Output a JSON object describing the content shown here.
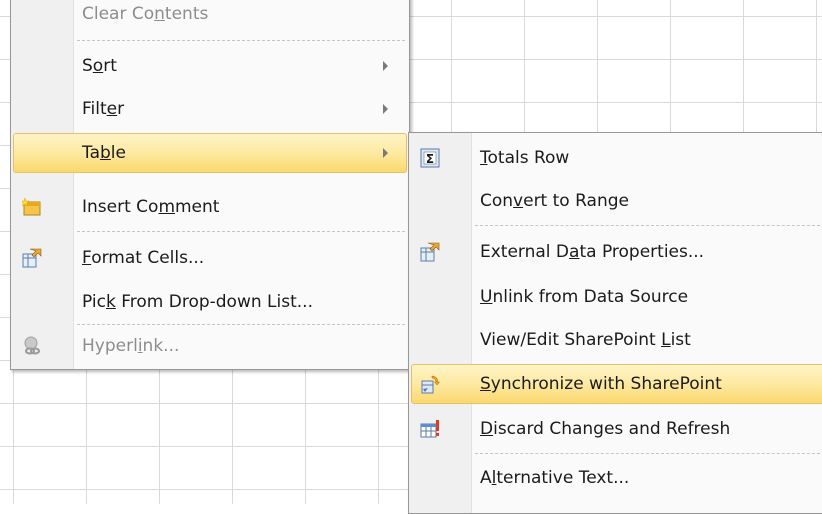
{
  "context_menu": {
    "items": [
      {
        "key": "clear_contents",
        "text": "Clear Contents",
        "pre": "Clear Co",
        "ul": "n",
        "post": "tents"
      },
      {
        "key": "sort",
        "text": "Sort",
        "pre": "S",
        "ul": "o",
        "post": "rt",
        "submenu": true
      },
      {
        "key": "filter",
        "text": "Filter",
        "pre": "Filt",
        "ul": "e",
        "post": "r",
        "submenu": true
      },
      {
        "key": "table",
        "text": "Table",
        "pre": "Ta",
        "ul": "b",
        "post": "le",
        "submenu": true,
        "highlighted": true
      },
      {
        "key": "insert_comment",
        "text": "Insert Comment",
        "pre": "Insert Co",
        "ul": "m",
        "post": "ment",
        "icon": "comment-icon"
      },
      {
        "key": "format_cells",
        "text": "Format Cells...",
        "pre": "",
        "ul": "F",
        "post": "ormat Cells...",
        "icon": "format-cells-icon"
      },
      {
        "key": "pick_list",
        "text": "Pick From Drop-down List...",
        "pre": "Pic",
        "ul": "k",
        "post": " From Drop-down List..."
      },
      {
        "key": "hyperlink",
        "text": "Hyperlink...",
        "pre": "Hyperl",
        "ul": "i",
        "post": "nk...",
        "icon": "hyperlink-icon",
        "disabled": true
      }
    ]
  },
  "table_submenu": {
    "items": [
      {
        "key": "totals_row",
        "text": "Totals Row",
        "pre": "",
        "ul": "T",
        "post": "otals Row",
        "icon": "sigma-icon"
      },
      {
        "key": "convert_range",
        "text": "Convert to Range",
        "pre": "Con",
        "ul": "v",
        "post": "ert to Range"
      },
      {
        "key": "external_props",
        "text": "External Data Properties...",
        "pre": "External D",
        "ul": "a",
        "post": "ta Properties...",
        "icon": "properties-icon"
      },
      {
        "key": "unlink",
        "text": "Unlink from Data Source",
        "pre": "",
        "ul": "U",
        "post": "nlink from Data Source"
      },
      {
        "key": "view_edit",
        "text": "View/Edit SharePoint List",
        "pre": "View/Edit SharePoint ",
        "ul": "L",
        "post": "ist"
      },
      {
        "key": "synchronize",
        "text": "Synchronize with SharePoint",
        "pre": "",
        "ul": "S",
        "post": "ynchronize with SharePoint",
        "icon": "sync-icon",
        "highlighted": true
      },
      {
        "key": "discard",
        "text": "Discard Changes and Refresh",
        "pre": "",
        "ul": "D",
        "post": "iscard Changes and Refresh",
        "icon": "discard-refresh-icon"
      },
      {
        "key": "alt_text",
        "text": "Alternative Text...",
        "pre": "A",
        "ul": "l",
        "post": "ternative Text..."
      }
    ]
  },
  "colors": {
    "highlight_border": "#e5c365",
    "highlight_fill": "#fde9a1",
    "disabled_text": "#8d8d8d"
  }
}
